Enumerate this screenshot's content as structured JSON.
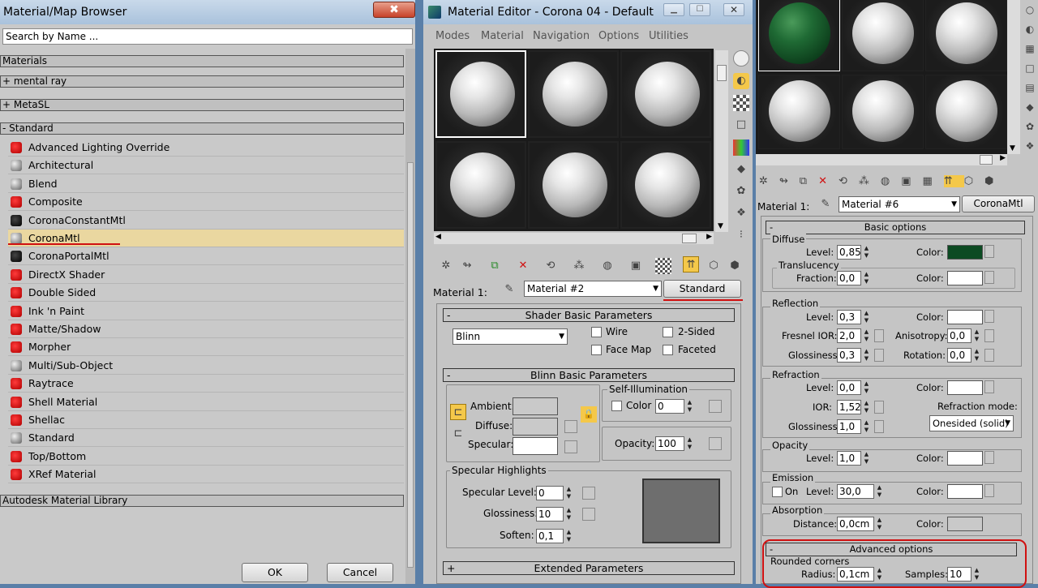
{
  "browser": {
    "title": "Material/Map Browser",
    "close": "✖",
    "search_placeholder": "Search by Name ...",
    "categories": {
      "materials": "Materials",
      "mental_ray": "+ mental ray",
      "metasl": "+ MetaSL",
      "standard": "-  Standard",
      "library": "Autodesk Material Library"
    },
    "items": [
      {
        "label": "Advanced Lighting Override",
        "icon": "red"
      },
      {
        "label": "Architectural",
        "icon": "grey"
      },
      {
        "label": "Blend",
        "icon": "grey"
      },
      {
        "label": "Composite",
        "icon": "red"
      },
      {
        "label": "CoronaConstantMtl",
        "icon": "black"
      },
      {
        "label": "CoronaMtl",
        "icon": "grey"
      },
      {
        "label": "CoronaPortalMtl",
        "icon": "black"
      },
      {
        "label": "DirectX Shader",
        "icon": "red"
      },
      {
        "label": "Double Sided",
        "icon": "red"
      },
      {
        "label": "Ink 'n Paint",
        "icon": "red"
      },
      {
        "label": "Matte/Shadow",
        "icon": "red"
      },
      {
        "label": "Morpher",
        "icon": "red"
      },
      {
        "label": "Multi/Sub-Object",
        "icon": "grey"
      },
      {
        "label": "Raytrace",
        "icon": "red"
      },
      {
        "label": "Shell Material",
        "icon": "red"
      },
      {
        "label": "Shellac",
        "icon": "red"
      },
      {
        "label": "Standard",
        "icon": "grey"
      },
      {
        "label": "Top/Bottom",
        "icon": "red"
      },
      {
        "label": "XRef Material",
        "icon": "red"
      }
    ],
    "ok": "OK",
    "cancel": "Cancel"
  },
  "editor": {
    "title": "Material Editor - Corona 04 - Default",
    "menu": [
      "Modes",
      "Material",
      "Navigation",
      "Options",
      "Utilities"
    ],
    "material_label": "Material 1:",
    "material_name": "Material #2",
    "type_button": "Standard",
    "shader": {
      "head": "Shader Basic Parameters",
      "type": "Blinn",
      "wire": "Wire",
      "two_sided": "2-Sided",
      "face_map": "Face Map",
      "faceted": "Faceted"
    },
    "blinn": {
      "head": "Blinn Basic Parameters",
      "self_illum": "Self-Illumination",
      "color": "Color",
      "color_val": "0",
      "ambient": "Ambient:",
      "diffuse": "Diffuse:",
      "specular": "Specular:",
      "opacity": "Opacity:",
      "opacity_val": "100",
      "spec_high": "Specular Highlights",
      "spec_level": "Specular Level:",
      "spec_level_val": "0",
      "glossiness": "Glossiness:",
      "gloss_val": "10",
      "soften": "Soften:",
      "soften_val": "0,1"
    },
    "extended": "Extended Parameters"
  },
  "corona": {
    "material_label": "Material 1:",
    "material_name": "Material #6",
    "type_button": "CoronaMtl",
    "basic_head": "Basic options",
    "diffuse": {
      "title": "Diffuse",
      "level": "Level:",
      "level_val": "0,85",
      "color": "Color:",
      "color_hex": "#0c4a22"
    },
    "translucency": {
      "title": "Translucency",
      "fraction": "Fraction:",
      "fraction_val": "0,0",
      "color": "Color:"
    },
    "reflection": {
      "title": "Reflection",
      "level": "Level:",
      "level_val": "0,3",
      "color": "Color:",
      "fresnel": "Fresnel IOR:",
      "fresnel_val": "2,0",
      "aniso": "Anisotropy:",
      "aniso_val": "0,0",
      "gloss": "Glossiness:",
      "gloss_val": "0,3",
      "rotation": "Rotation:",
      "rotation_val": "0,0"
    },
    "refraction": {
      "title": "Refraction",
      "level": "Level:",
      "level_val": "0,0",
      "color": "Color:",
      "ior": "IOR:",
      "ior_val": "1,52",
      "mode_label": "Refraction mode:",
      "mode": "Onesided (solid)",
      "gloss": "Glossiness:",
      "gloss_val": "1,0"
    },
    "opacity": {
      "title": "Opacity",
      "level": "Level:",
      "level_val": "1,0",
      "color": "Color:"
    },
    "emission": {
      "title": "Emission",
      "on": "On",
      "level": "Level:",
      "level_val": "30,0",
      "color": "Color:"
    },
    "absorption": {
      "title": "Absorption",
      "distance": "Distance:",
      "distance_val": "0,0cm",
      "color": "Color:"
    },
    "advanced_head": "Advanced options",
    "rounded": {
      "title": "Rounded corners",
      "radius": "Radius:",
      "radius_val": "0,1cm",
      "samples": "Samples:",
      "samples_val": "10"
    }
  },
  "colors": {
    "accent_red": "#d01010",
    "selected_row": "#ead7a0",
    "diffuse_green": "#0c4a22"
  }
}
